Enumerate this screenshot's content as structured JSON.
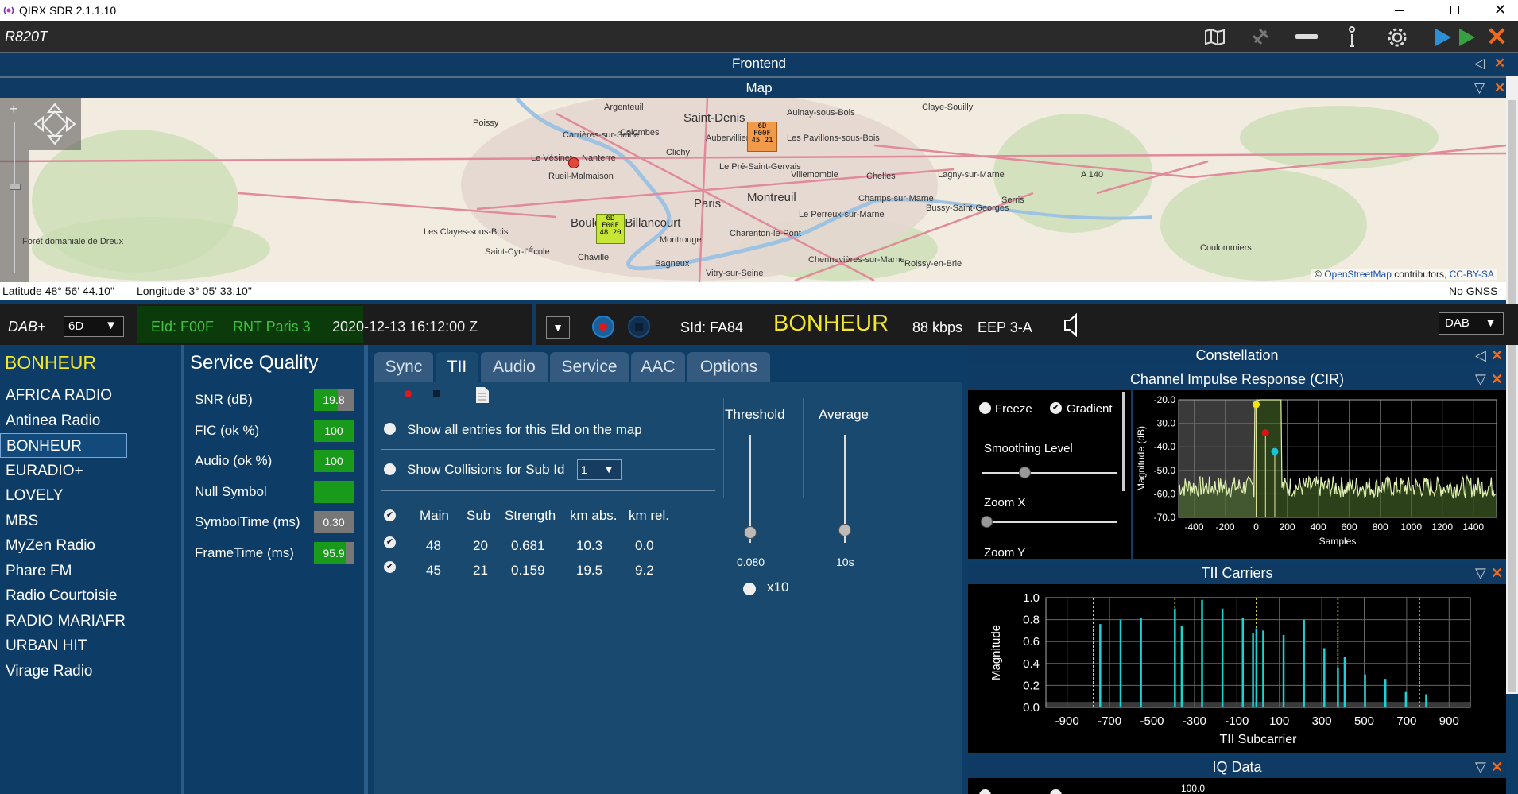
{
  "app": {
    "title": "QIRX SDR 2.1.1.10",
    "device": "R820T"
  },
  "sections": {
    "frontend": "Frontend",
    "map": "Map"
  },
  "map": {
    "labels": [
      "Argenteuil",
      "Saint-Denis",
      "Aulnay-sous-Bois",
      "Claye-Souilly",
      "Poissy",
      "Carrières-sur-Seine",
      "Colombes",
      "Aubervilliers",
      "Les Pavillons-sous-Bois",
      "Le Vésinet",
      "Nanterre",
      "Clichy",
      "Rueil-Malmaison",
      "Le Pré-Saint-Gervais",
      "Villemomble",
      "Chelles",
      "Lagny-sur-Marne",
      "A 140",
      "Paris",
      "Montreuil",
      "Champs-sur-Marne",
      "Serris",
      "Bussy-Saint-Georges",
      "Boulogne-Billancourt",
      "Le Perreux-sur-Marne",
      "Les Clayes-sous-Bois",
      "Montrouge",
      "Charenton-le-Pont",
      "Forêt domaniale de Dreux",
      "Saint-Cyr-l'École",
      "Chaville",
      "Bagneux",
      "Vitry-sur-Seine",
      "Chennevières-sur-Marne",
      "Roissy-en-Brie",
      "Coulommiers"
    ],
    "marker_a": [
      "6D",
      "F00F",
      "45",
      "21"
    ],
    "marker_b": [
      "6D",
      "F00F",
      "48",
      "20"
    ],
    "attribution": {
      "prefix": "©",
      "link": "OpenStreetMap",
      "mid": "contributors,",
      "license": "CC-BY-SA"
    },
    "latitude": "Latitude  48° 56' 44.10\"",
    "longitude": "Longitude  3° 05' 33.10\"",
    "gnss": "No GNSS"
  },
  "dab": {
    "mode": "DAB+",
    "channel": "6D",
    "eid": "EId: F00F",
    "ensemble": "RNT Paris 3",
    "datetime": "2020-12-13  16:12:00 Z",
    "sid": "SId: FA84",
    "service": "BONHEUR",
    "bitrate": "88 kbps",
    "protection": "EEP 3-A",
    "band": "DAB"
  },
  "services": {
    "title": "BONHEUR",
    "items": [
      "AFRICA RADIO",
      "Antinea Radio",
      "BONHEUR",
      "EURADIO+",
      "LOVELY",
      "MBS",
      "MyZen Radio",
      "Phare FM",
      "Radio Courtoisie",
      "RADIO MARIAFR",
      "URBAN HIT",
      "Virage Radio"
    ],
    "selected": 2
  },
  "quality": {
    "title": "Service Quality",
    "rows": [
      {
        "label": "SNR (dB)",
        "value": "19.8",
        "level": 0.6,
        "color": "#1a9a1a"
      },
      {
        "label": "FIC (ok %)",
        "value": "100",
        "level": 1.0,
        "color": "#1a9a1a"
      },
      {
        "label": "Audio (ok %)",
        "value": "100",
        "level": 1.0,
        "color": "#1a9a1a"
      },
      {
        "label": "Null Symbol",
        "value": "",
        "level": 1.0,
        "color": "#1a9a1a"
      },
      {
        "label": "SymbolTime (ms)",
        "value": "0.30",
        "level": 0.0,
        "color": "#1a9a1a"
      },
      {
        "label": "FrameTime (ms)",
        "value": "95.9",
        "level": 0.8,
        "color": "#1a9a1a"
      }
    ]
  },
  "tabs": [
    "Sync",
    "TII",
    "Audio",
    "Service",
    "AAC",
    "Options"
  ],
  "tii": {
    "show_all": "Show all entries for this EId on the map",
    "collisions": "Show Collisions for Sub Id",
    "sub_id": "1",
    "columns": [
      "Main",
      "Sub",
      "Strength",
      "km abs.",
      "km rel."
    ],
    "rows": [
      [
        "48",
        "20",
        "0.681",
        "10.3",
        "0.0"
      ],
      [
        "45",
        "21",
        "0.159",
        "19.5",
        "9.2"
      ]
    ],
    "threshold_label": "Threshold",
    "threshold_value": "0.080",
    "average_label": "Average",
    "average_value": "10s",
    "x10": "x10"
  },
  "right": {
    "constellation": "Constellation",
    "cir_title": "Channel Impulse Response (CIR)",
    "freeze": "Freeze",
    "gradient": "Gradient",
    "smoothing": "Smoothing Level",
    "zoomx": "Zoom X",
    "zoomy": "Zoom Y",
    "tii_title": "TII Carriers",
    "iq_title": "IQ Data",
    "iq_tick": "100.0"
  },
  "chart_data": [
    {
      "type": "line",
      "title": "",
      "xlabel": "Samples",
      "ylabel": "Magnitude (dB)",
      "x_ticks": [
        "-400",
        "-200",
        "0",
        "200",
        "400",
        "600",
        "800",
        "1000",
        "1200",
        "1400"
      ],
      "y_ticks": [
        "-20.0",
        "-30.0",
        "-40.0",
        "-50.0",
        "-60.0",
        "-70.0"
      ],
      "xlim": [
        -500,
        1550
      ],
      "ylim": [
        -70,
        -20
      ],
      "peaks": [
        {
          "x": 0,
          "y": -22,
          "color": "#f5e400"
        },
        {
          "x": 60,
          "y": -34,
          "color": "#e01010"
        },
        {
          "x": 120,
          "y": -42,
          "color": "#19c3d8"
        }
      ],
      "noise_floor": -57
    },
    {
      "type": "bar",
      "title": "",
      "xlabel": "TII Subcarrier",
      "ylabel": "Magnitude",
      "x_ticks": [
        "-900",
        "-700",
        "-500",
        "-300",
        "-100",
        "100",
        "300",
        "500",
        "700",
        "900"
      ],
      "y_ticks": [
        "1.0",
        "0.8",
        "0.6",
        "0.4",
        "0.2",
        "0.0"
      ],
      "xlim": [
        -1000,
        1000
      ],
      "ylim": [
        0,
        1
      ],
      "markers_x": [
        -776,
        -392,
        -8,
        376,
        760
      ],
      "bars": [
        {
          "x": -744,
          "v": 0.76
        },
        {
          "x": -648,
          "v": 0.8
        },
        {
          "x": -552,
          "v": 0.82
        },
        {
          "x": -392,
          "v": 0.9
        },
        {
          "x": -360,
          "v": 0.74
        },
        {
          "x": -264,
          "v": 0.98
        },
        {
          "x": -168,
          "v": 0.9
        },
        {
          "x": -72,
          "v": 0.82
        },
        {
          "x": 24,
          "v": 0.7
        },
        {
          "x": 120,
          "v": 0.66
        },
        {
          "x": 216,
          "v": 0.8
        },
        {
          "x": 312,
          "v": 0.54
        },
        {
          "x": 376,
          "v": 0.36
        },
        {
          "x": 408,
          "v": 0.46
        },
        {
          "x": 504,
          "v": 0.3
        },
        {
          "x": 600,
          "v": 0.26
        },
        {
          "x": 696,
          "v": 0.14
        },
        {
          "x": 792,
          "v": 0.12
        },
        {
          "x": -8,
          "v": 0.72
        },
        {
          "x": -24,
          "v": 0.68
        }
      ]
    }
  ]
}
